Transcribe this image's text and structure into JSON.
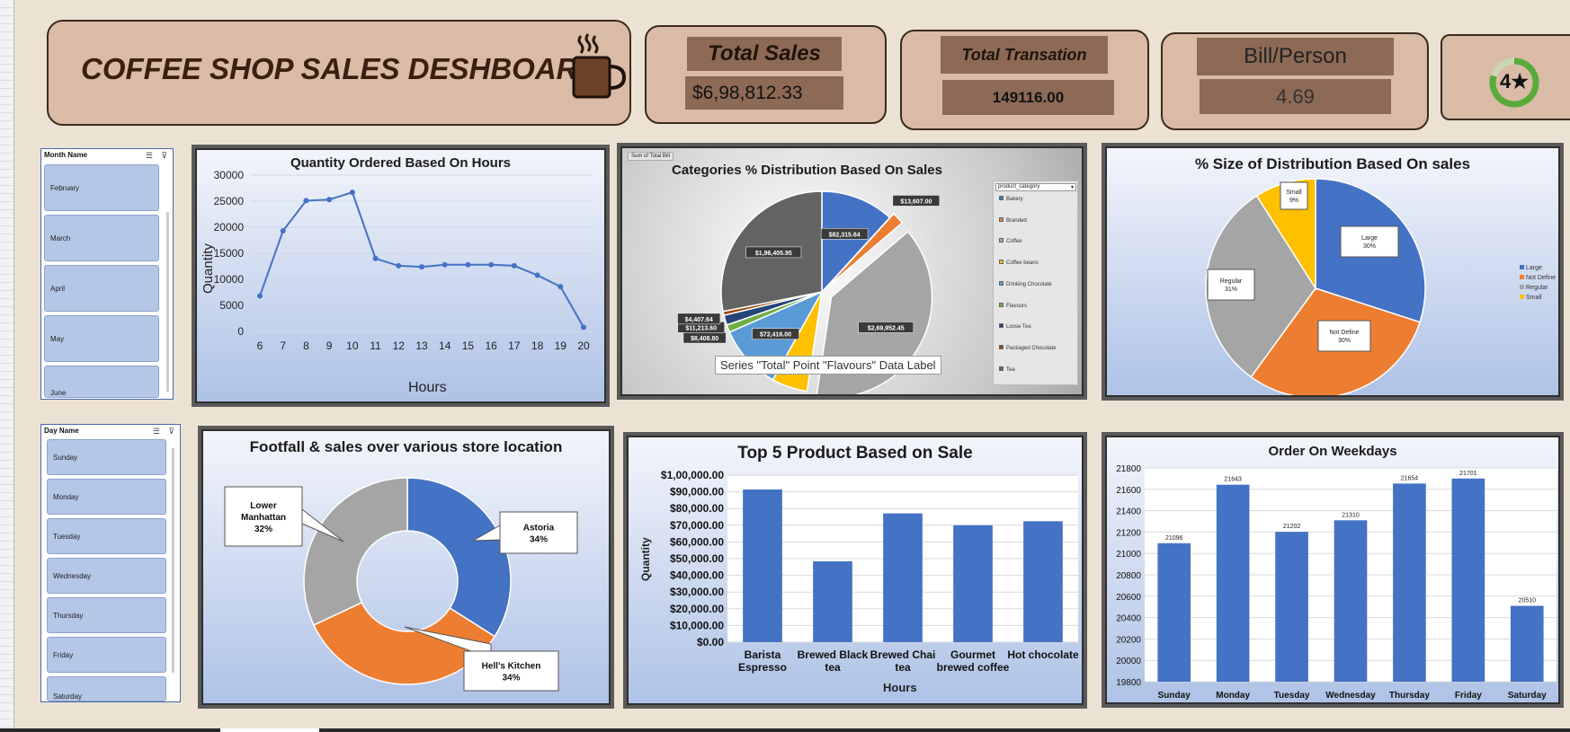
{
  "header": {
    "title": "COFFEE SHOP SALES DESHBOARD"
  },
  "kpis": [
    {
      "label": "Total Sales",
      "value": "$6,98,812.33"
    },
    {
      "label": "Total Transation",
      "value": "149116.00"
    },
    {
      "label": "Bill/Person",
      "value": "4.69"
    },
    {
      "label": "",
      "value": "4★"
    }
  ],
  "slicers": {
    "month": {
      "header": "Month Name",
      "items": [
        "February",
        "March",
        "April",
        "May",
        "June"
      ]
    },
    "day": {
      "header": "Day Name",
      "items": [
        "Sunday",
        "Monday",
        "Tuesday",
        "Wednesday",
        "Thursday",
        "Friday",
        "Saturday"
      ]
    }
  },
  "charts": {
    "hours": {
      "title": "Quantity Ordered Based On Hours",
      "xlabel": "Hours",
      "ylabel": "Quantity"
    },
    "categories": {
      "title": "Categories % Distribution Based On Sales",
      "field_button": "Sum of Total Bill",
      "filter_label": "product_category",
      "tooltip": "Series \"Total\" Point \"Flavours\" Data Label"
    },
    "size": {
      "title": "% Size of Distribution Based On sales"
    },
    "footfall": {
      "title": "Footfall & sales  over various store location"
    },
    "top5": {
      "title": "Top 5 Product Based on Sale",
      "xlabel": "Hours",
      "ylabel": "Quantity"
    },
    "weekday": {
      "title": "Order On Weekdays"
    }
  },
  "chart_data": [
    {
      "type": "line",
      "title": "Quantity Ordered Based On Hours",
      "xlabel": "Hours",
      "ylabel": "Quantity",
      "x": [
        6,
        7,
        8,
        9,
        10,
        11,
        12,
        13,
        14,
        15,
        16,
        17,
        18,
        19,
        20
      ],
      "values": [
        6800,
        19300,
        25100,
        25300,
        26700,
        14000,
        12600,
        12400,
        12800,
        12800,
        12800,
        12600,
        10800,
        8600,
        800
      ],
      "ylim": [
        0,
        30000
      ],
      "yticks": [
        "0",
        "5000",
        "10000",
        "15000",
        "20000",
        "25000",
        "30000"
      ],
      "color": "#4472c4"
    },
    {
      "type": "pie",
      "title": "Categories % Distribution Based On Sales",
      "slices": [
        {
          "name": "Bakery",
          "value": 82315.64,
          "label": "$82,315.64",
          "color": "#4472c4"
        },
        {
          "name": "Branded",
          "value": 13607.0,
          "label": "$13,607.00",
          "color": "#ed7d31"
        },
        {
          "name": "Coffee",
          "value": 269952.45,
          "label": "$2,69,952.45",
          "color": "#a5a5a5"
        },
        {
          "name": "Coffee beans",
          "value": 40085.25,
          "label": "$40,085.25",
          "color": "#ffc000"
        },
        {
          "name": "Drinking Chocolate",
          "value": 72416.0,
          "label": "$72,416.00",
          "color": "#5b9bd5"
        },
        {
          "name": "Flavours",
          "value": 8408.8,
          "label": "$8,408.80",
          "color": "#70ad47"
        },
        {
          "name": "Loose Tea",
          "value": 11213.6,
          "label": "$11,213.60",
          "color": "#264478"
        },
        {
          "name": "Packaged Chocolate",
          "value": 4407.64,
          "label": "$4,407.64",
          "color": "#9e480e"
        },
        {
          "name": "Tea",
          "value": 196405.95,
          "label": "$1,96,405.95",
          "color": "#636363"
        }
      ]
    },
    {
      "type": "pie",
      "title": "% Size of Distribution Based On sales",
      "slices": [
        {
          "name": "Large",
          "value": 30,
          "label": "Large\n30%",
          "color": "#4472c4"
        },
        {
          "name": "Not Define",
          "value": 30,
          "label": "Not Define\n30%",
          "color": "#ed7d31"
        },
        {
          "name": "Regular",
          "value": 31,
          "label": "Regular\n31%",
          "color": "#a5a5a5"
        },
        {
          "name": "Small",
          "value": 9,
          "label": "Small\n9%",
          "color": "#ffc000"
        }
      ]
    },
    {
      "type": "pie",
      "subtype": "doughnut",
      "title": "Footfall & sales  over various store location",
      "slices": [
        {
          "name": "Astoria",
          "value": 34,
          "label": "Astoria\n34%",
          "color": "#4472c4"
        },
        {
          "name": "Hell's Kitchen",
          "value": 34,
          "label": "Hell's Kitchen\n34%",
          "color": "#ed7d31"
        },
        {
          "name": "Lower Manhattan",
          "value": 32,
          "label": "Lower\nManhattan\n32%",
          "color": "#a5a5a5"
        }
      ]
    },
    {
      "type": "bar",
      "title": "Top 5 Product Based on Sale",
      "xlabel": "Hours",
      "ylabel": "Quantity",
      "categories": [
        "Barista Espresso",
        "Brewed Black tea",
        "Brewed Chai tea",
        "Gourmet brewed coffee",
        "Hot chocolate"
      ],
      "category_lines": [
        [
          "Barista",
          "Espresso"
        ],
        [
          "Brewed Black",
          "tea"
        ],
        [
          "Brewed Chai",
          "tea"
        ],
        [
          "Gourmet",
          "brewed coffee"
        ],
        [
          "Hot chocolate"
        ]
      ],
      "values": [
        91400,
        48400,
        77100,
        70000,
        72400
      ],
      "ylim": [
        0,
        100000
      ],
      "yticks": [
        "$0.00",
        "$10,000.00",
        "$20,000.00",
        "$30,000.00",
        "$40,000.00",
        "$50,000.00",
        "$60,000.00",
        "$70,000.00",
        "$80,000.00",
        "$90,000.00",
        "$1,00,000.00"
      ],
      "color": "#4472c4"
    },
    {
      "type": "bar",
      "title": "Order On Weekdays",
      "categories": [
        "Sunday",
        "Monday",
        "Tuesday",
        "Wednesday",
        "Thursday",
        "Friday",
        "Saturday"
      ],
      "values": [
        21096,
        21643,
        21202,
        21310,
        21654,
        21701,
        20510
      ],
      "ylim": [
        19800,
        21800
      ],
      "yticks": [
        "19800",
        "20000",
        "20200",
        "20400",
        "20600",
        "20800",
        "21000",
        "21200",
        "21400",
        "21600",
        "21800"
      ],
      "color": "#4472c4"
    }
  ]
}
